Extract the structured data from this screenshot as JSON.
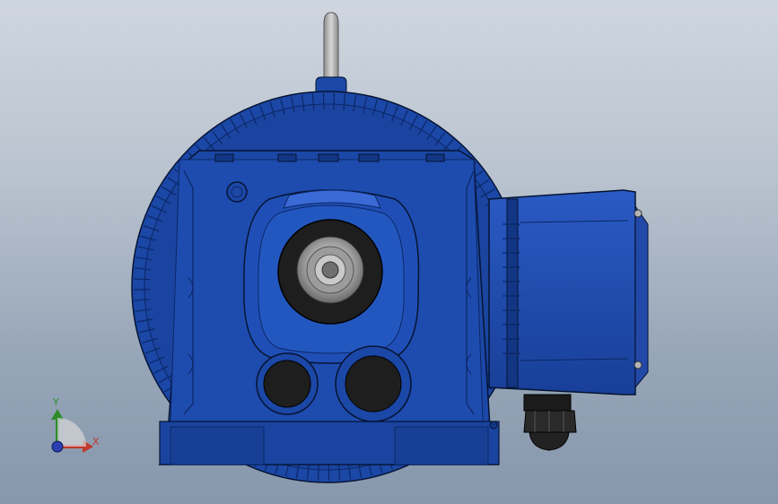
{
  "viewport": {
    "colors": {
      "body_blue": "#1b47a6",
      "dark_blue": "#0f2d75",
      "mid_blue": "#2a5ac4",
      "bore_dark": "#1e1e1e",
      "bearing_grey": "#a8a8a8",
      "outline": "#061433",
      "triad_x": "#c0392b",
      "triad_y": "#2e8b2e",
      "triad_z": "#2b3fb0"
    },
    "parts": {
      "lifting_eye": "lifting-eye",
      "motor_fan_housing": "fan-cover",
      "gear_housing": "gear-housing",
      "output_shaft_bore": "hollow-shaft-bore",
      "terminal_box": "terminal-box",
      "cable_gland": "cable-gland"
    }
  },
  "triad": {
    "y_label": "Y",
    "x_label": "X"
  }
}
